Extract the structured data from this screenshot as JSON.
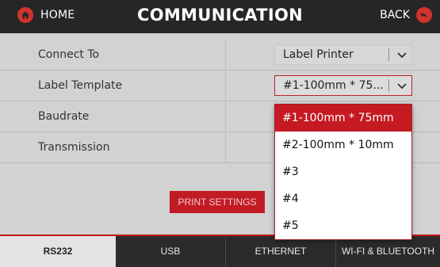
{
  "header": {
    "home_label": "HOME",
    "title": "COMMUNICATION",
    "back_label": "BACK",
    "home_icon": "home-icon",
    "back_icon": "back-arrow-icon",
    "accent_color": "#d0342c"
  },
  "settings": {
    "rows": [
      {
        "label": "Connect To",
        "value": "Label Printer"
      },
      {
        "label": "Label Template",
        "value": "#1-100mm * 75..."
      },
      {
        "label": "Baudrate"
      },
      {
        "label": "Transmission"
      }
    ],
    "print_button": "PRINT SETTINGS"
  },
  "dropdown": {
    "options": [
      "#1-100mm * 75mm",
      "#2-100mm * 10mm",
      "#3",
      "#4",
      "#5"
    ],
    "selected": "#1-100mm * 75mm",
    "selected_color": "#c51a22"
  },
  "tabs": {
    "items": [
      "RS232",
      "USB",
      "ETHERNET",
      "WI-FI & BLUETOOTH"
    ],
    "active": "RS232"
  }
}
